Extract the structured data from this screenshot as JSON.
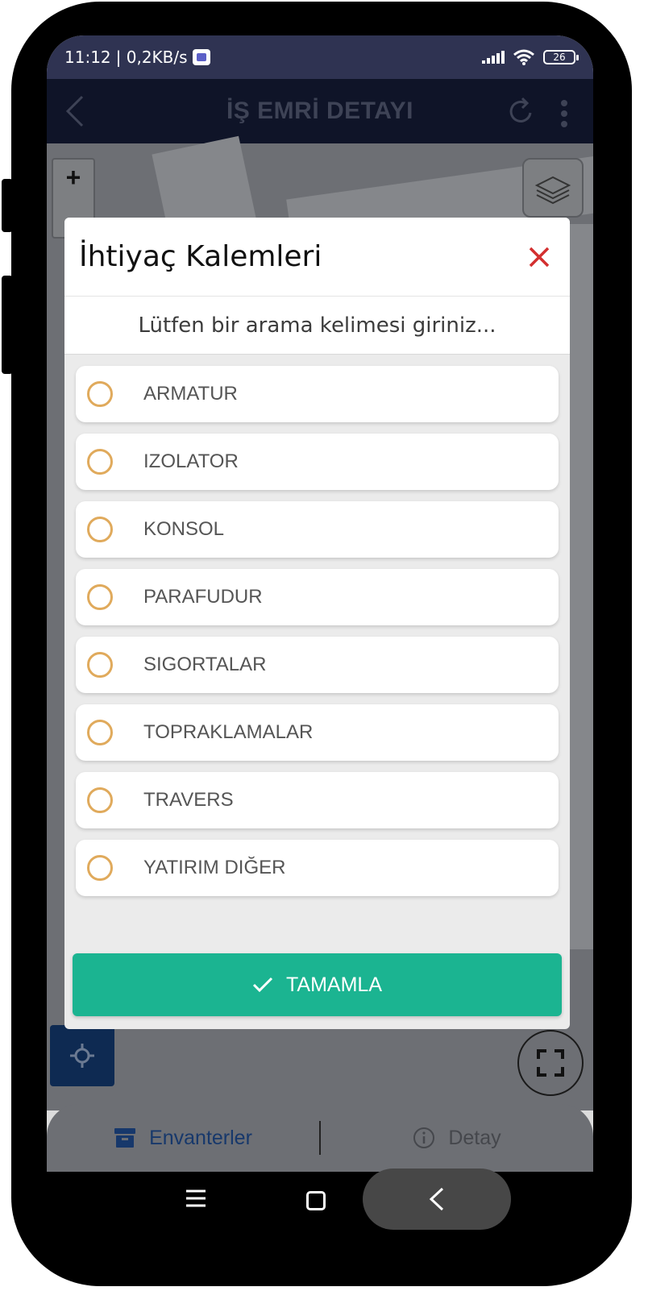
{
  "status_bar": {
    "time": "11:12",
    "speed": "| 0,2KB/s",
    "battery": "26"
  },
  "app_bar": {
    "title": "İŞ EMRİ DETAYI"
  },
  "map": {
    "zoom_in_label": "+"
  },
  "modal": {
    "title": "İhtiyaç Kalemleri",
    "search_placeholder": "Lütfen bir arama kelimesi giriniz...",
    "items": [
      {
        "label": "ARMATUR"
      },
      {
        "label": "IZOLATOR"
      },
      {
        "label": "KONSOL"
      },
      {
        "label": "PARAFUDUR"
      },
      {
        "label": "SIGORTALAR"
      },
      {
        "label": "TOPRAKLAMALAR"
      },
      {
        "label": "TRAVERS"
      },
      {
        "label": "YATIRIM DIĞER"
      }
    ],
    "complete_label": "TAMAMLA"
  },
  "bottom_tabs": {
    "inventory_label": "Envanterler",
    "detail_label": "Detay"
  },
  "colors": {
    "accent": "#1bb491",
    "radio_border": "#e0aa5c",
    "close_icon": "#d32f2f",
    "header_bg": "#0f1428",
    "status_bg": "#2f3352"
  }
}
